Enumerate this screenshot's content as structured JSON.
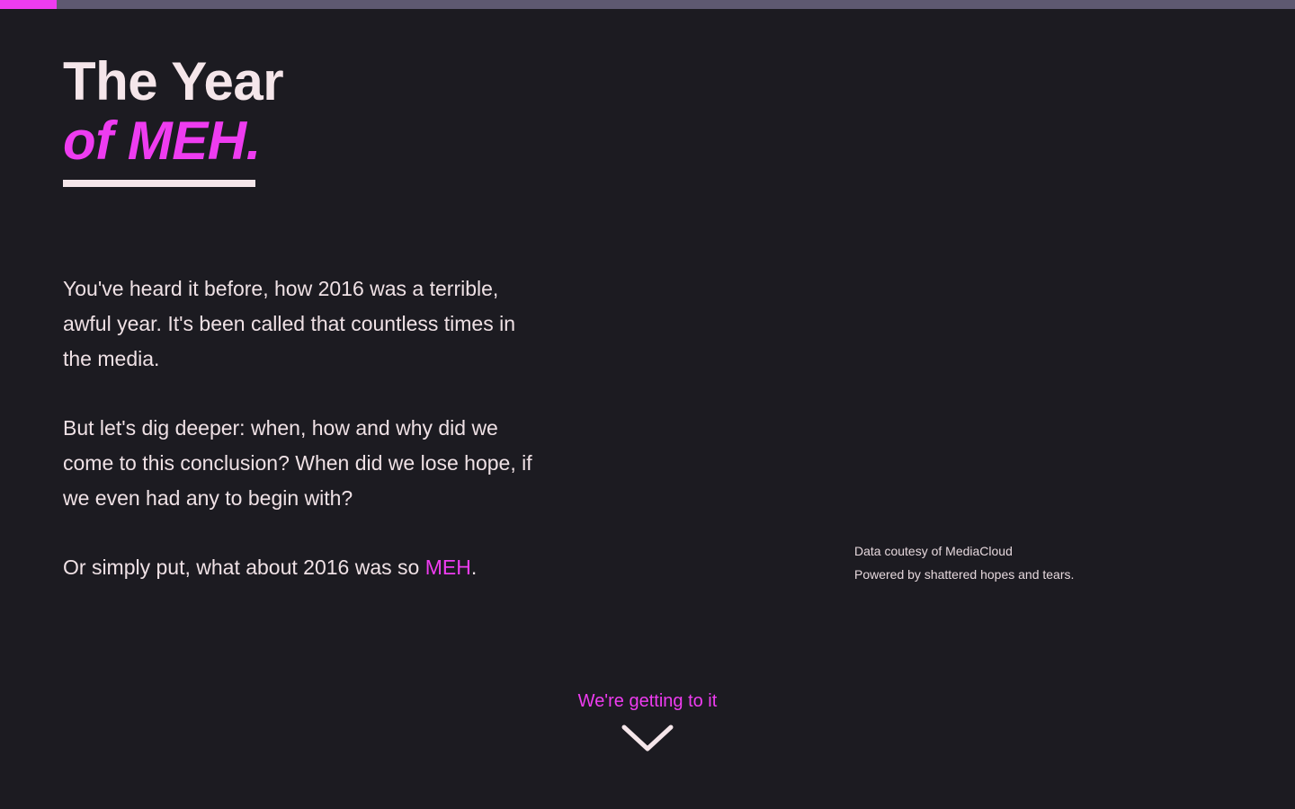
{
  "progress": {
    "fraction": 0.044,
    "fill_color": "#ee3cf0",
    "track_color": "#5e5971"
  },
  "header": {
    "title_line1": "The Year",
    "title_line2": "of MEH."
  },
  "intro": {
    "paragraph1": "You've heard it before, how 2016 was a terrible, awful year. It's been called that countless times in the media.",
    "paragraph2": "But let's dig deeper: when, how and why did we come to this conclusion? When did we lose hope, if we even had any to begin with?",
    "paragraph3_prefix": "Or simply put, what about 2016 was so ",
    "paragraph3_highlight": "MEH",
    "paragraph3_suffix": "."
  },
  "credits": {
    "line1": "Data coutesy of MediaCloud",
    "line2": "Powered by shattered hopes and tears."
  },
  "scroll_cta": {
    "label": "We're getting to it",
    "icon": "chevron-down-icon"
  },
  "colors": {
    "background": "#1c1b21",
    "accent": "#ee3cf0",
    "text": "#f5e6ea"
  }
}
